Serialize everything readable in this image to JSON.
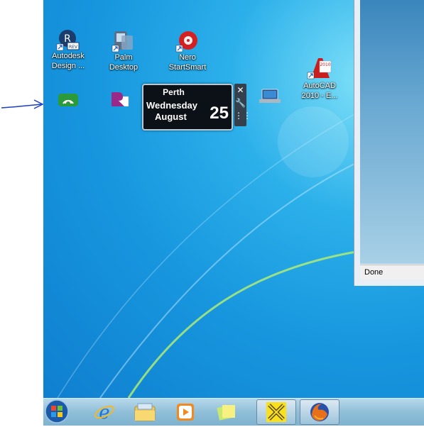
{
  "desktop_icons": [
    {
      "label_line1": "Autodesk",
      "label_line2": "Design ..."
    },
    {
      "label_line1": "Palm",
      "label_line2": "Desktop"
    },
    {
      "label_line1": "Nero",
      "label_line2": "StartSmart"
    },
    {
      "label_line1": "AutoCAD",
      "label_line2": "2010 - E..."
    },
    {
      "label_line1": "",
      "label_line2": ""
    },
    {
      "label_line1": "",
      "label_line2": ""
    },
    {
      "label_line1": "",
      "label_line2": ""
    }
  ],
  "clock_gadget": {
    "city": "Perth",
    "day": "Wednesday",
    "month": "August",
    "date": "25"
  },
  "gadget_tools": {
    "close": "✕",
    "settings": "🔧",
    "drag": "⋮⋮"
  },
  "browser": {
    "status": "Done"
  },
  "autocad_badge": "2010",
  "taskbar": {
    "items": [
      "start",
      "internet-explorer",
      "windows-explorer",
      "media-player",
      "sticky-notes",
      "autocad-app",
      "firefox"
    ]
  },
  "colors": {
    "annotation_arrow": "#1a3fbf",
    "desktop": "#1796de"
  }
}
